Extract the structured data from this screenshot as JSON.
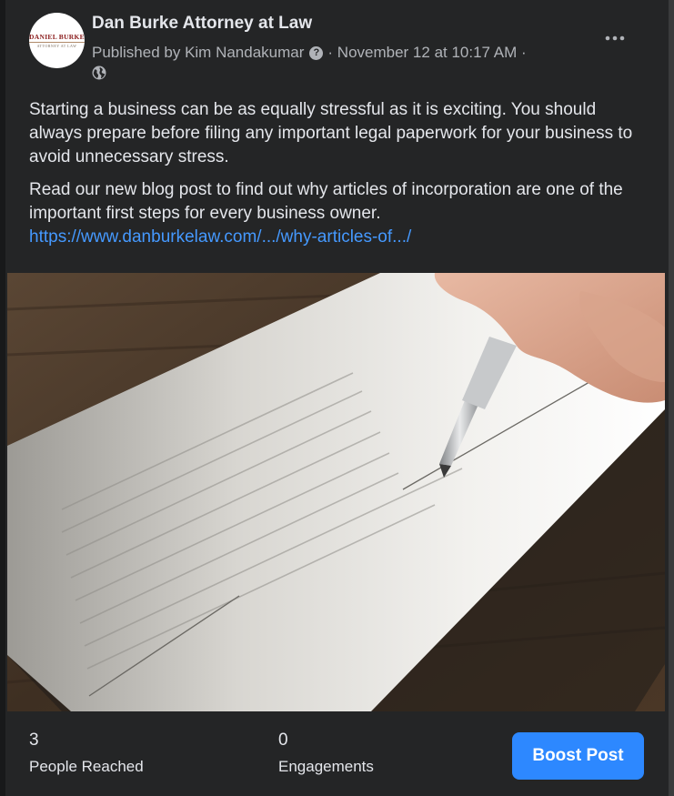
{
  "post": {
    "page_name": "Dan Burke Attorney at Law",
    "avatar_logo_text": "DANIEL BURKE",
    "avatar_logo_sub": "ATTORNEY AT LAW",
    "published_by": "Published by Kim Nandakumar",
    "help_glyph": "?",
    "timestamp": "· November 12 at 10:17 AM ·",
    "audience_icon": "globe-icon",
    "paragraph_1": "Starting a business can be as equally stressful as it is exciting. You should always prepare before filing any important legal paperwork for your business to avoid unnecessary stress.",
    "paragraph_2": "Read our new blog post to find out why articles of incorporation are one of the important first steps for every business owner.",
    "link_text": "https://www.danburkelaw.com/.../why-articles-of.../"
  },
  "stats": {
    "people_reached_value": "3",
    "people_reached_label": "People Reached",
    "engagements_value": "0",
    "engagements_label": "Engagements"
  },
  "actions": {
    "boost_label": "Boost Post",
    "more_icon": "more-options-icon"
  },
  "colors": {
    "background": "#242526",
    "text_primary": "#e4e6eb",
    "text_secondary": "#b0b3b8",
    "link": "#4599ff",
    "accent": "#2d88ff"
  }
}
